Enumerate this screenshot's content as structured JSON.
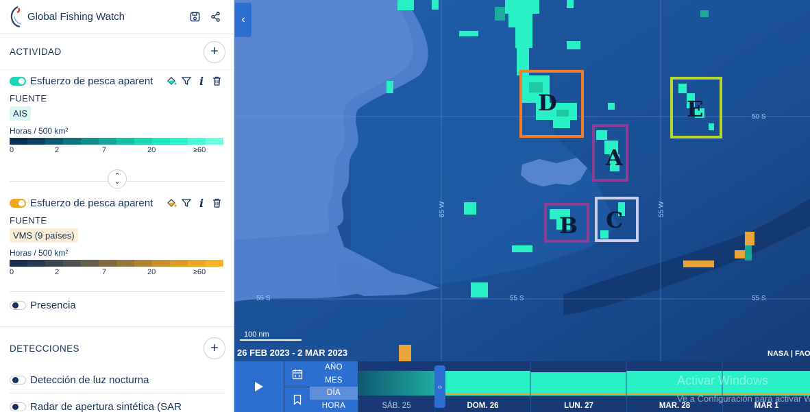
{
  "app": {
    "title": "Global Fishing Watch"
  },
  "activity": {
    "section_title": "ACTIVIDAD",
    "layers": [
      {
        "name": "Esfuerzo de pesca aparent",
        "source_label": "FUENTE",
        "source": "AIS",
        "unit": "Horas / 500 km²",
        "ticks": [
          "0",
          "2",
          "7",
          "20",
          "≥60"
        ],
        "color": "#1fd4b4"
      },
      {
        "name": "Esfuerzo de pesca aparent",
        "source_label": "FUENTE",
        "source": "VMS (9 países)",
        "unit": "Horas / 500 km²",
        "ticks": [
          "0",
          "2",
          "7",
          "20",
          "≥60"
        ],
        "color": "#f2a625"
      }
    ],
    "presence": "Presencia"
  },
  "detections": {
    "section_title": "DETECCIONES",
    "items": [
      "Detección de luz nocturna",
      "Radar de apertura sintética (SAR"
    ]
  },
  "map": {
    "grid_labels": [
      "50 S",
      "65 W",
      "55 W",
      "55 S",
      "55 S",
      "55 S"
    ],
    "boxes": [
      {
        "label": "D",
        "color": "#f07d2c"
      },
      {
        "label": "E",
        "color": "#b8d630"
      },
      {
        "label": "A",
        "color": "#8a3f93"
      },
      {
        "label": "B",
        "color": "#8a3f93"
      },
      {
        "label": "C",
        "color": "#c9cde8"
      }
    ],
    "scale": "100 nm",
    "date_range": "26 FEB 2023 - 2 MAR 2023",
    "attribution": "NASA | FAO"
  },
  "timebar": {
    "resolutions": [
      "AÑO",
      "MES",
      "DÍA",
      "HORA"
    ],
    "active_resolution": "DÍA",
    "days": [
      "SÁB. 25",
      "DOM. 26",
      "LUN. 27",
      "MAR. 28",
      "MAR 1"
    ]
  },
  "watermark": {
    "title": "Activar Windows",
    "subtitle": "Ve a Configuración para activar Windows."
  }
}
